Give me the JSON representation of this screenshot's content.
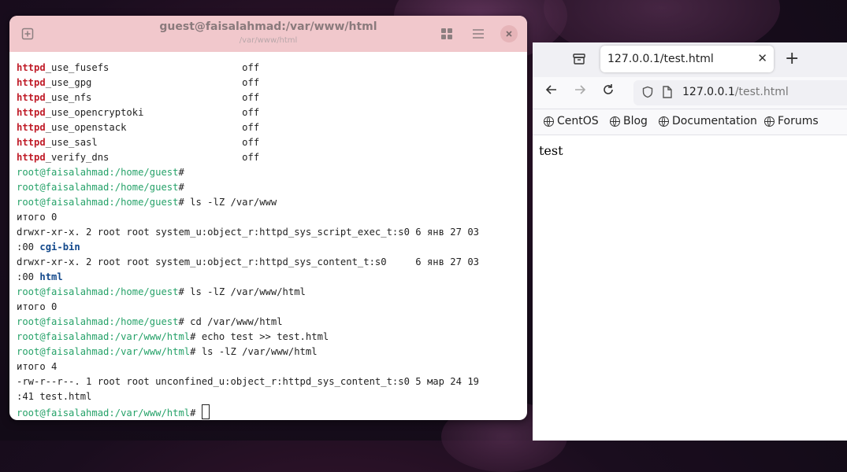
{
  "terminal": {
    "title": "guest@faisalahmad:/var/www/html",
    "subtitle": "/var/www/html",
    "lines": [
      {
        "parts": [
          {
            "t": "httpd",
            "c": "hl"
          },
          {
            "t": "_use_fusefs                       off",
            "c": ""
          }
        ]
      },
      {
        "parts": [
          {
            "t": "httpd",
            "c": "hl"
          },
          {
            "t": "_use_gpg                          off",
            "c": ""
          }
        ]
      },
      {
        "parts": [
          {
            "t": "httpd",
            "c": "hl"
          },
          {
            "t": "_use_nfs                          off",
            "c": ""
          }
        ]
      },
      {
        "parts": [
          {
            "t": "httpd",
            "c": "hl"
          },
          {
            "t": "_use_opencryptoki                 off",
            "c": ""
          }
        ]
      },
      {
        "parts": [
          {
            "t": "httpd",
            "c": "hl"
          },
          {
            "t": "_use_openstack                    off",
            "c": ""
          }
        ]
      },
      {
        "parts": [
          {
            "t": "httpd",
            "c": "hl"
          },
          {
            "t": "_use_sasl                         off",
            "c": ""
          }
        ]
      },
      {
        "parts": [
          {
            "t": "httpd",
            "c": "hl"
          },
          {
            "t": "_verify_dns                       off",
            "c": ""
          }
        ]
      },
      {
        "parts": [
          {
            "t": "root@faisalahmad",
            "c": "prompt"
          },
          {
            "t": ":/home/guest",
            "c": "prompt"
          },
          {
            "t": "#",
            "c": ""
          }
        ]
      },
      {
        "parts": [
          {
            "t": "root@faisalahmad",
            "c": "prompt"
          },
          {
            "t": ":/home/guest",
            "c": "prompt"
          },
          {
            "t": "#",
            "c": ""
          }
        ]
      },
      {
        "parts": [
          {
            "t": "root@faisalahmad",
            "c": "prompt"
          },
          {
            "t": ":/home/guest",
            "c": "prompt"
          },
          {
            "t": "# ls -lZ /var/www",
            "c": ""
          }
        ]
      },
      {
        "parts": [
          {
            "t": "итого 0",
            "c": ""
          }
        ]
      },
      {
        "parts": [
          {
            "t": "drwxr-xr-x. 2 root root system_u:object_r:httpd_sys_script_exec_t:s0 6 янв 27 03",
            "c": ""
          }
        ]
      },
      {
        "parts": [
          {
            "t": ":00 ",
            "c": ""
          },
          {
            "t": "cgi-bin",
            "c": "dir"
          }
        ]
      },
      {
        "parts": [
          {
            "t": "drwxr-xr-x. 2 root root system_u:object_r:httpd_sys_content_t:s0     6 янв 27 03",
            "c": ""
          }
        ]
      },
      {
        "parts": [
          {
            "t": ":00 ",
            "c": ""
          },
          {
            "t": "html",
            "c": "dir"
          }
        ]
      },
      {
        "parts": [
          {
            "t": "root@faisalahmad",
            "c": "prompt"
          },
          {
            "t": ":/home/guest",
            "c": "prompt"
          },
          {
            "t": "# ls -lZ /var/www/html",
            "c": ""
          }
        ]
      },
      {
        "parts": [
          {
            "t": "итого 0",
            "c": ""
          }
        ]
      },
      {
        "parts": [
          {
            "t": "root@faisalahmad",
            "c": "prompt"
          },
          {
            "t": ":/home/guest",
            "c": "prompt"
          },
          {
            "t": "# cd /var/www/html",
            "c": ""
          }
        ]
      },
      {
        "parts": [
          {
            "t": "root@faisalahmad",
            "c": "prompt"
          },
          {
            "t": ":/var/www/html",
            "c": "prompt"
          },
          {
            "t": "# echo test >> test.html",
            "c": ""
          }
        ]
      },
      {
        "parts": [
          {
            "t": "root@faisalahmad",
            "c": "prompt"
          },
          {
            "t": ":/var/www/html",
            "c": "prompt"
          },
          {
            "t": "# ls -lZ /var/www/html",
            "c": ""
          }
        ]
      },
      {
        "parts": [
          {
            "t": "итого 4",
            "c": ""
          }
        ]
      },
      {
        "parts": [
          {
            "t": "-rw-r--r--. 1 root root unconfined_u:object_r:httpd_sys_content_t:s0 5 мар 24 19",
            "c": ""
          }
        ]
      },
      {
        "parts": [
          {
            "t": ":41 test.html",
            "c": ""
          }
        ]
      },
      {
        "parts": [
          {
            "t": "root@faisalahmad",
            "c": "prompt"
          },
          {
            "t": ":/var/www/html",
            "c": "prompt"
          },
          {
            "t": "# ",
            "c": ""
          }
        ],
        "cursor": true
      }
    ]
  },
  "browser": {
    "tab_title": "127.0.0.1/test.html",
    "url_host": "127.0.0.1",
    "url_path": "/test.html",
    "bookmarks": [
      "CentOS",
      "Blog",
      "Documentation",
      "Forums"
    ],
    "page_text": "test"
  },
  "icons": {
    "new_tab": "new-tab-icon",
    "grid": "grid-view-icon",
    "menu": "hamburger-menu-icon",
    "close": "close-icon"
  },
  "colors": {
    "terminal_header": "#f1c8cc",
    "prompt": "#26a269",
    "highlight": "#c01c28",
    "directory": "#12488b"
  }
}
